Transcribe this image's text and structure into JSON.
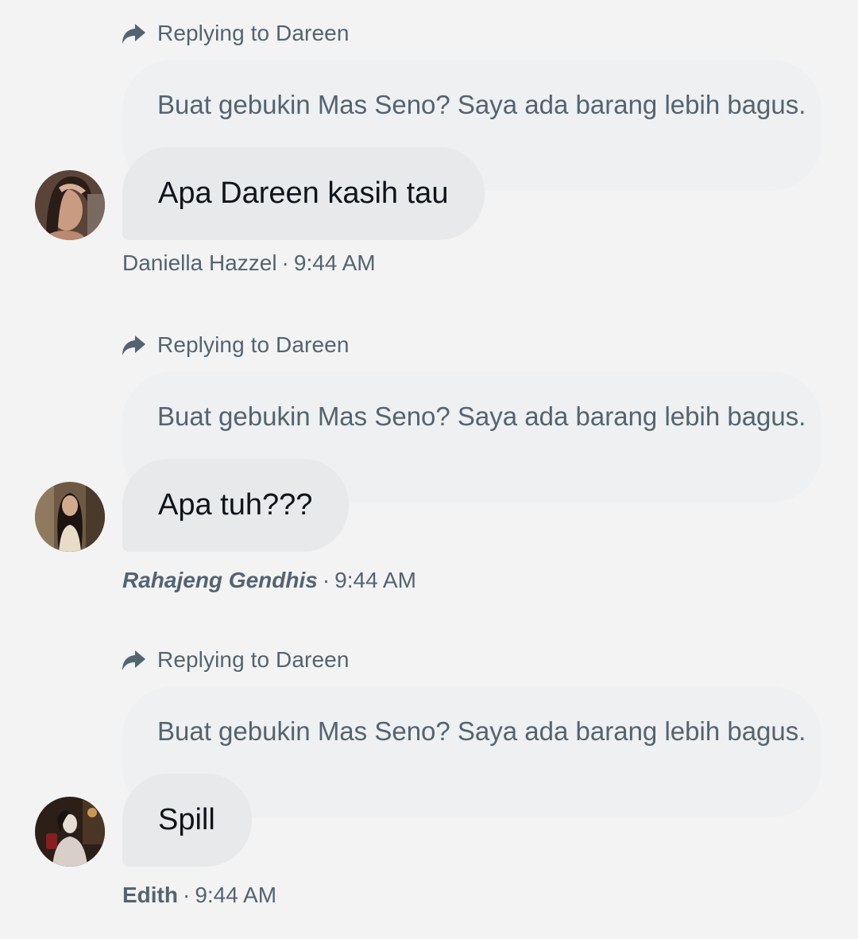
{
  "messages": [
    {
      "reply_label": "Replying to Dareen",
      "quoted_text": "Buat gebukin Mas Seno? Saya ada barang lebih bagus.",
      "text": "Apa Dareen kasih tau",
      "author": "Daniella Hazzel",
      "separator": "·",
      "time": "9:44 AM"
    },
    {
      "reply_label": "Replying to Dareen",
      "quoted_text": "Buat gebukin Mas Seno? Saya ada barang lebih bagus.",
      "text": "Apa tuh???",
      "author": "Rahajeng Gendhis",
      "separator": "·",
      "time": "9:44 AM"
    },
    {
      "reply_label": "Replying to Dareen",
      "quoted_text": "Buat gebukin Mas Seno? Saya ada barang lebih bagus.",
      "text": "Spill",
      "author": "Edith",
      "separator": "·",
      "time": "9:44 AM"
    }
  ],
  "icons": {
    "reply": "reply-arrow-icon",
    "avatar": "avatar"
  },
  "colors": {
    "background": "#f3f3f3",
    "quoted_bubble": "#eef0f1",
    "message_bubble": "#e7e9eb",
    "secondary_text": "#536471",
    "primary_text": "#0f1419"
  }
}
